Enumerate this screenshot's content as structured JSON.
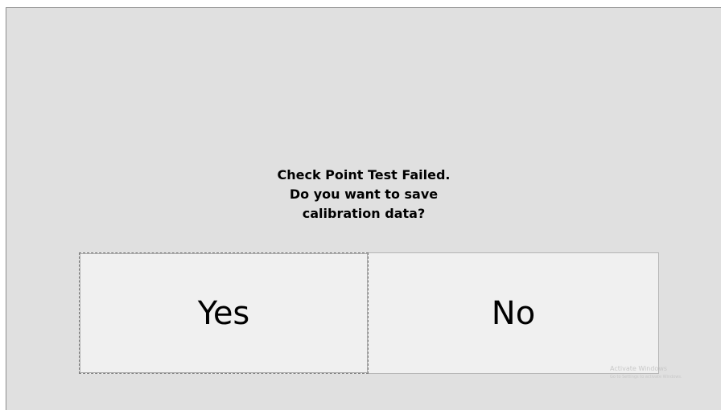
{
  "dialog": {
    "message_lines": [
      "Check Point Test Failed.",
      "Do you want to save",
      "calibration data?"
    ],
    "yes_label": "Yes",
    "no_label": "No"
  },
  "watermark": {
    "title": "Activate Windows",
    "subtitle": "Go to Settings to activate Windows."
  }
}
